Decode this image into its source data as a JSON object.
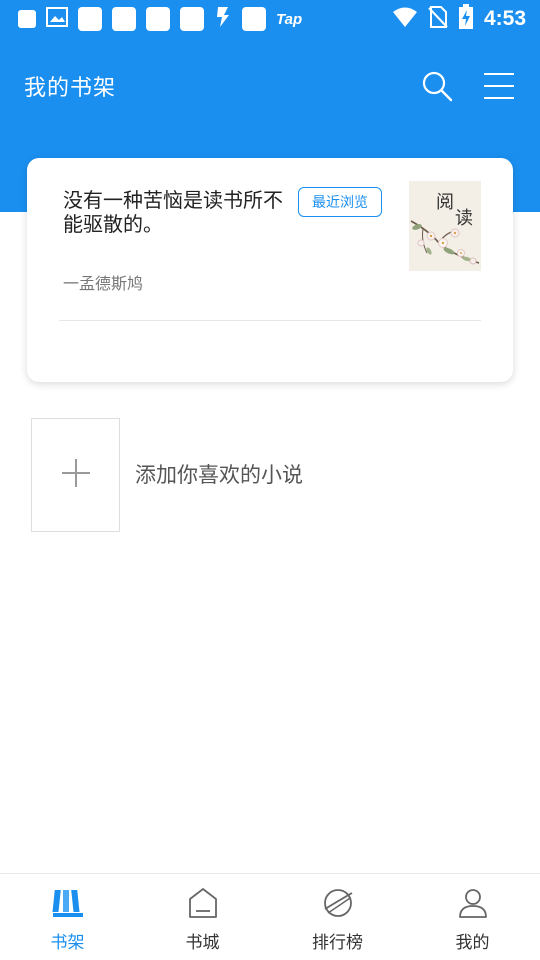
{
  "status_bar": {
    "time": "4:53",
    "tap_label": "Tap",
    "icons": [
      "notification-icon",
      "image-icon",
      "app-icon",
      "app-icon",
      "app-icon",
      "app-icon",
      "lightning-icon",
      "app-icon",
      "wifi-icon",
      "no-sim-icon",
      "battery-charging-icon"
    ]
  },
  "header": {
    "title": "我的书架",
    "icons": [
      "search-icon",
      "menu-icon"
    ]
  },
  "quote_card": {
    "quote": "没有一种苦恼是读书所不能驱散的。",
    "author": "一孟德斯鸠",
    "recent_button": "最近浏览",
    "cover_text": [
      "阅",
      "读"
    ]
  },
  "add_novel": {
    "label": "添加你喜欢的小说",
    "icon": "plus-icon"
  },
  "bottom_nav": {
    "items": [
      {
        "label": "书架",
        "icon": "bookshelf-icon",
        "active": true
      },
      {
        "label": "书城",
        "icon": "bookstore-icon",
        "active": false
      },
      {
        "label": "排行榜",
        "icon": "ranking-icon",
        "active": false
      },
      {
        "label": "我的",
        "icon": "user-icon",
        "active": false
      }
    ]
  },
  "colors": {
    "primary": "#1a8ff0",
    "text": "#222222",
    "muted": "#777777"
  }
}
